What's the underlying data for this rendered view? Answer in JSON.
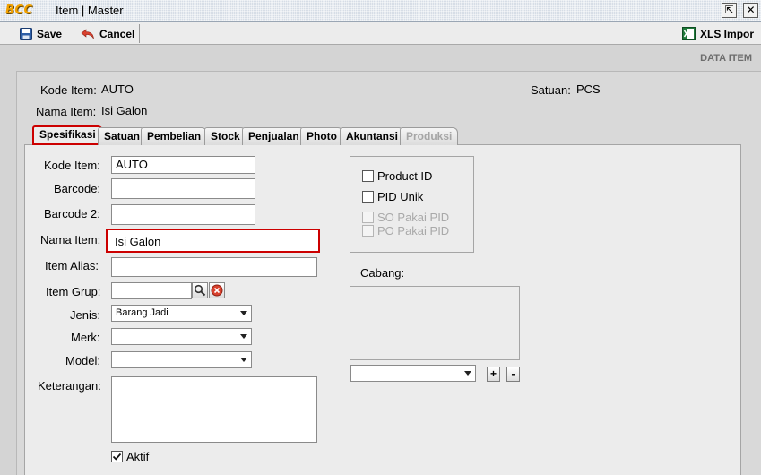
{
  "window": {
    "logo_text": "BCC",
    "title": "Item | Master",
    "restore_glyph": "⇱",
    "close_glyph": "✕"
  },
  "toolbar": {
    "save_label": "Save",
    "save_access_key": "S",
    "save_rest": "ave",
    "cancel_label": "Cancel",
    "cancel_access_key": "C",
    "cancel_rest": "ancel",
    "xls_label": "XLS Impor",
    "xls_access_key": "X",
    "xls_rest": "LS Impor"
  },
  "header": {
    "section_title": "DATA ITEM",
    "kode_item_label": "Kode Item:",
    "kode_item_value": "AUTO",
    "nama_item_label": "Nama Item:",
    "nama_item_value": "Isi Galon",
    "satuan_label": "Satuan:",
    "satuan_value": "PCS"
  },
  "tabs": [
    {
      "label": "Spesifikasi"
    },
    {
      "label": "Satuan"
    },
    {
      "label": "Pembelian"
    },
    {
      "label": "Stock"
    },
    {
      "label": "Penjualan"
    },
    {
      "label": "Photo"
    },
    {
      "label": "Akuntansi"
    },
    {
      "label": "Produksi"
    }
  ],
  "form": {
    "kode_item": {
      "label": "Kode Item:",
      "value": "AUTO"
    },
    "barcode": {
      "label": "Barcode:",
      "value": ""
    },
    "barcode2": {
      "label": "Barcode 2:",
      "value": ""
    },
    "nama_item": {
      "label": "Nama Item:",
      "value": "Isi Galon"
    },
    "item_alias": {
      "label": "Item Alias:",
      "value": ""
    },
    "item_grup": {
      "label": "Item Grup:",
      "value": ""
    },
    "jenis": {
      "label": "Jenis:",
      "value": "Barang Jadi"
    },
    "merk": {
      "label": "Merk:",
      "value": ""
    },
    "model": {
      "label": "Model:",
      "value": ""
    },
    "keterangan": {
      "label": "Keterangan:",
      "value": ""
    },
    "aktif": {
      "label": "Aktif",
      "checked": true
    }
  },
  "pid_group": {
    "product_id": {
      "label": "Product ID",
      "checked": false
    },
    "pid_unik": {
      "label": "PID Unik",
      "checked": false
    },
    "so_pakai_pid": {
      "label": "SO Pakai PID",
      "checked": false,
      "enabled": false
    },
    "po_pakai_pid": {
      "label": "PO Pakai PID",
      "checked": false,
      "enabled": false
    }
  },
  "cabang": {
    "label": "Cabang:",
    "select_value": "",
    "add_label": "+",
    "remove_label": "-"
  },
  "colors": {
    "highlight": "#cc0000",
    "title_bar": "#d6dde6",
    "panel": "#ececec"
  }
}
